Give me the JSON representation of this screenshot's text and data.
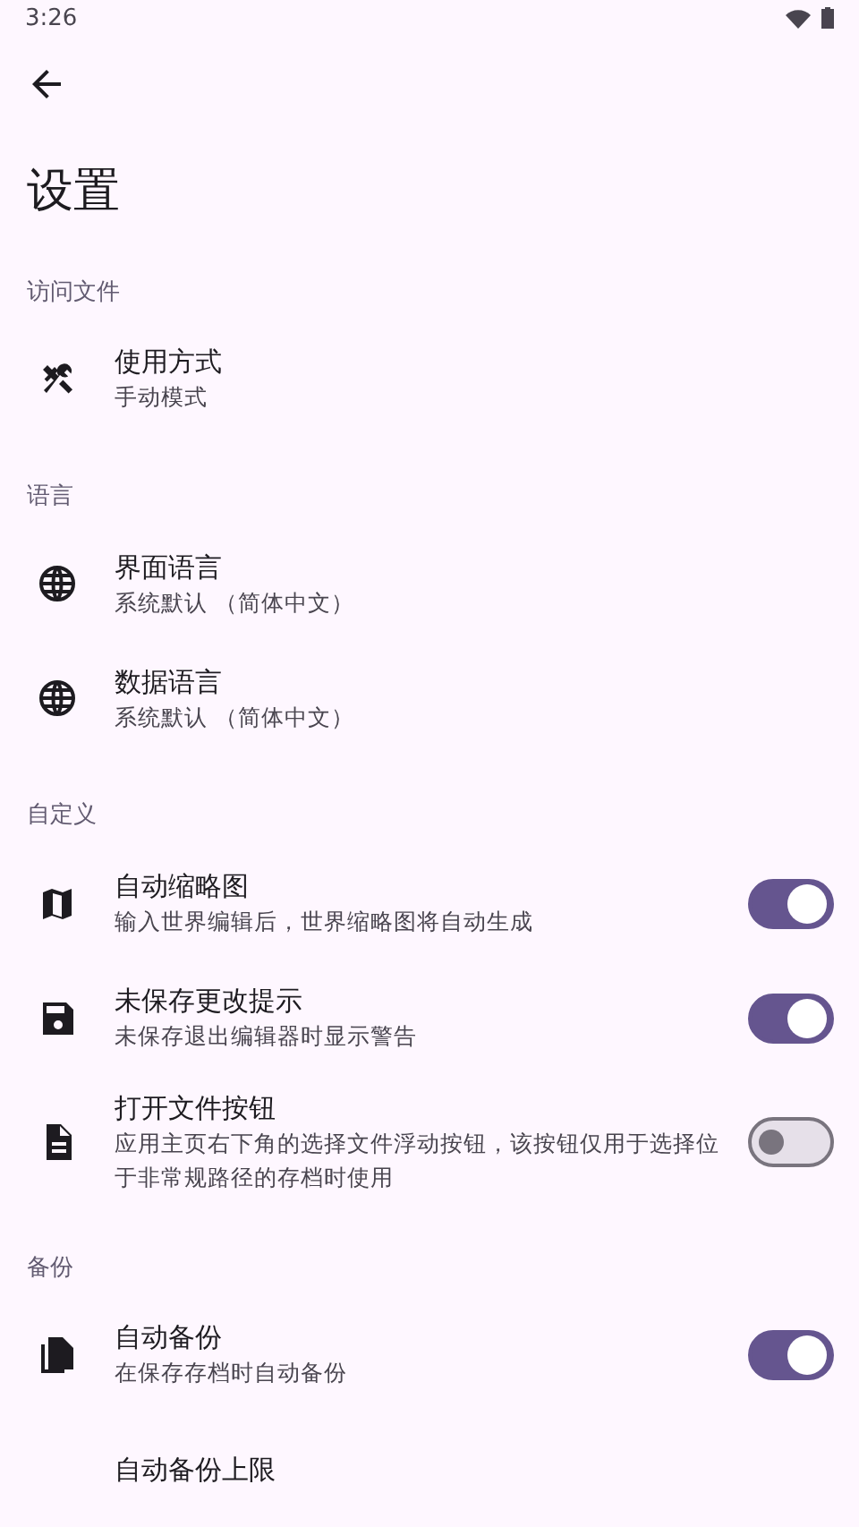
{
  "status_bar": {
    "time": "3:26"
  },
  "title": "设置",
  "sections": [
    {
      "header": "访问文件",
      "items": [
        {
          "kind": "text",
          "title": "使用方式",
          "subtitle": "手动模式"
        }
      ]
    },
    {
      "header": "语言",
      "items": [
        {
          "kind": "text",
          "title": "界面语言",
          "subtitle": "系统默认 （简体中文）"
        },
        {
          "kind": "text",
          "title": "数据语言",
          "subtitle": "系统默认 （简体中文）"
        }
      ]
    },
    {
      "header": "自定义",
      "items": [
        {
          "kind": "switch",
          "title": "自动缩略图",
          "subtitle": "输入世界编辑后，世界缩略图将自动生成",
          "on": true
        },
        {
          "kind": "switch",
          "title": "未保存更改提示",
          "subtitle": "未保存退出编辑器时显示警告",
          "on": true
        },
        {
          "kind": "switch",
          "title": "打开文件按钮",
          "subtitle": "应用主页右下角的选择文件浮动按钮，该按钮仅用于选择位于非常规路径的存档时使用",
          "on": false
        }
      ]
    },
    {
      "header": "备份",
      "items": [
        {
          "kind": "switch",
          "title": "自动备份",
          "subtitle": "在保存存档时自动备份",
          "on": true
        },
        {
          "kind": "text",
          "title": "自动备份上限"
        }
      ]
    }
  ]
}
